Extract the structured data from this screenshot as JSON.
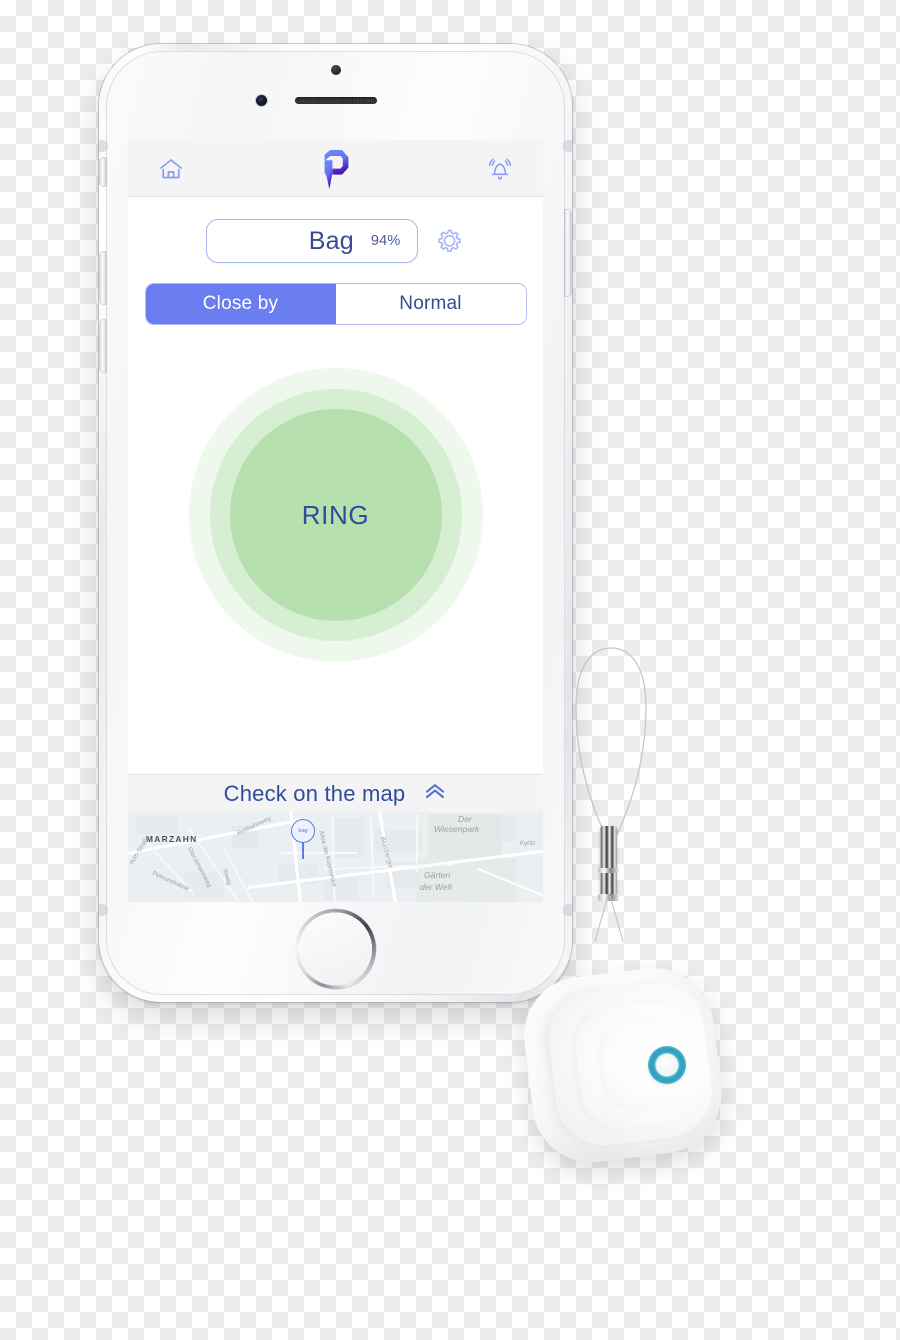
{
  "app": {
    "topbar": {
      "home_icon": "home-icon",
      "logo_icon": "app-logo-icon",
      "bell_icon": "ringing-bell-icon"
    },
    "device": {
      "name": "Bag",
      "battery": "94%",
      "settings_icon": "gear-icon"
    },
    "range_control": {
      "options": [
        {
          "label": "Close by",
          "active": true
        },
        {
          "label": "Normal",
          "active": false
        }
      ]
    },
    "ring": {
      "label": "RING"
    },
    "map": {
      "header_label": "Check on the map",
      "collapse_icon": "double-chevron-up-icon",
      "marker_label": "bag",
      "labels": [
        {
          "text": "MARZAHN",
          "kind": "town"
        },
        {
          "text": "Rebhuhnweg",
          "kind": "street"
        },
        {
          "text": "Sterckmannweg",
          "kind": "street"
        },
        {
          "text": "Pekrunstrasse",
          "kind": "street"
        },
        {
          "text": "num-Straße",
          "kind": "street"
        },
        {
          "text": "rkweg",
          "kind": "street"
        },
        {
          "text": "Allee der Kosmonaut",
          "kind": "street"
        },
        {
          "text": "Blumberger",
          "kind": "street"
        },
        {
          "text": "Der",
          "kind": "park"
        },
        {
          "text": "Wiesenpark",
          "kind": "park"
        },
        {
          "text": "Gärten",
          "kind": "park"
        },
        {
          "text": "der Welt",
          "kind": "park"
        },
        {
          "text": "Kyritz",
          "kind": "street"
        }
      ]
    }
  },
  "hardware": {
    "phone": {
      "front_camera": "front-camera",
      "earpiece": "earpiece-speaker",
      "proximity_sensor": "proximity-sensor",
      "home_button": "home-button",
      "power_button": "power-button",
      "volume_up": "volume-up-button",
      "volume_down": "volume-down-button",
      "mute_switch": "mute-switch"
    },
    "tracker": {
      "lanyard": "lanyard-loop",
      "clasp": "lanyard-clasp",
      "led_ring": "tracker-led-ring"
    }
  },
  "colors": {
    "accent_blue": "#6a7ef2",
    "text_blue": "#3a4a8f",
    "ring_green": "#a0d696",
    "led_cyan": "#2f9ec0",
    "topbar_gray": "#f4f4f6"
  }
}
